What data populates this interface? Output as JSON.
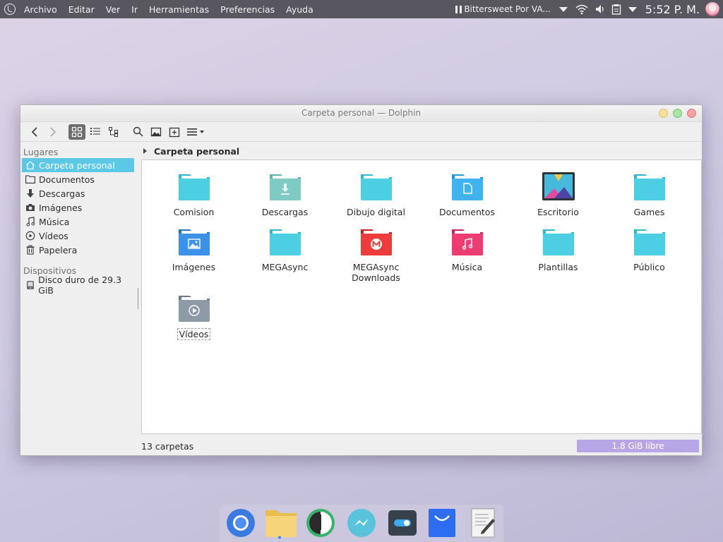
{
  "panel": {
    "menus": [
      "Archivo",
      "Editar",
      "Ver",
      "Ir",
      "Herramientas",
      "Preferencias",
      "Ayuda"
    ],
    "media_text": "Bittersweet Por VA...",
    "clock": "5:52 P. M."
  },
  "window": {
    "title": "Carpeta personal — Dolphin"
  },
  "sidebar": {
    "places_header": "Lugares",
    "places": [
      {
        "label": "Carpeta personal",
        "icon": "home-icon",
        "selected": true
      },
      {
        "label": "Documentos",
        "icon": "folder-icon"
      },
      {
        "label": "Descargas",
        "icon": "download-icon"
      },
      {
        "label": "Imágenes",
        "icon": "camera-icon"
      },
      {
        "label": "Música",
        "icon": "music-note-icon"
      },
      {
        "label": "Vídeos",
        "icon": "play-icon"
      },
      {
        "label": "Papelera",
        "icon": "trash-icon"
      }
    ],
    "devices_header": "Dispositivos",
    "devices": [
      {
        "label": "Disco duro de 29.3 GiB",
        "icon": "drive-icon"
      }
    ]
  },
  "breadcrumb": {
    "current": "Carpeta personal"
  },
  "files": [
    {
      "name": "Comision",
      "icon": "folder-icon",
      "color": "#4dcfe3"
    },
    {
      "name": "Descargas",
      "icon": "folder-download-icon",
      "color": "#7fcbc4"
    },
    {
      "name": "Dibujo digital",
      "icon": "folder-icon",
      "color": "#4dcfe3"
    },
    {
      "name": "Documentos",
      "icon": "folder-documents-icon",
      "color": "#41b3ee"
    },
    {
      "name": "Escritorio",
      "icon": "desktop-icon",
      "color": "#2e3338"
    },
    {
      "name": "Games",
      "icon": "folder-icon",
      "color": "#4dcfe3"
    },
    {
      "name": "Imágenes",
      "icon": "folder-pictures-icon",
      "color": "#3b92e8"
    },
    {
      "name": "MEGAsync",
      "icon": "folder-icon",
      "color": "#4dcfe3"
    },
    {
      "name": "MEGAsync Downloads",
      "icon": "folder-mega-icon",
      "color": "#ee3b3b"
    },
    {
      "name": "Música",
      "icon": "folder-music-icon",
      "color": "#ec3c72"
    },
    {
      "name": "Plantillas",
      "icon": "folder-icon",
      "color": "#4dcfe3"
    },
    {
      "name": "Público",
      "icon": "folder-icon",
      "color": "#4dcfe3"
    },
    {
      "name": "Vídeos",
      "icon": "folder-videos-icon",
      "color": "#8e9ba6"
    }
  ],
  "status": {
    "count": "13 carpetas",
    "free": "1.8 GiB libre"
  },
  "dock": [
    {
      "name": "chromium-icon"
    },
    {
      "name": "files-icon",
      "running": true
    },
    {
      "name": "audio-player-icon"
    },
    {
      "name": "messenger-icon"
    },
    {
      "name": "settings-toggle-icon"
    },
    {
      "name": "store-bag-icon"
    },
    {
      "name": "text-editor-icon"
    }
  ]
}
